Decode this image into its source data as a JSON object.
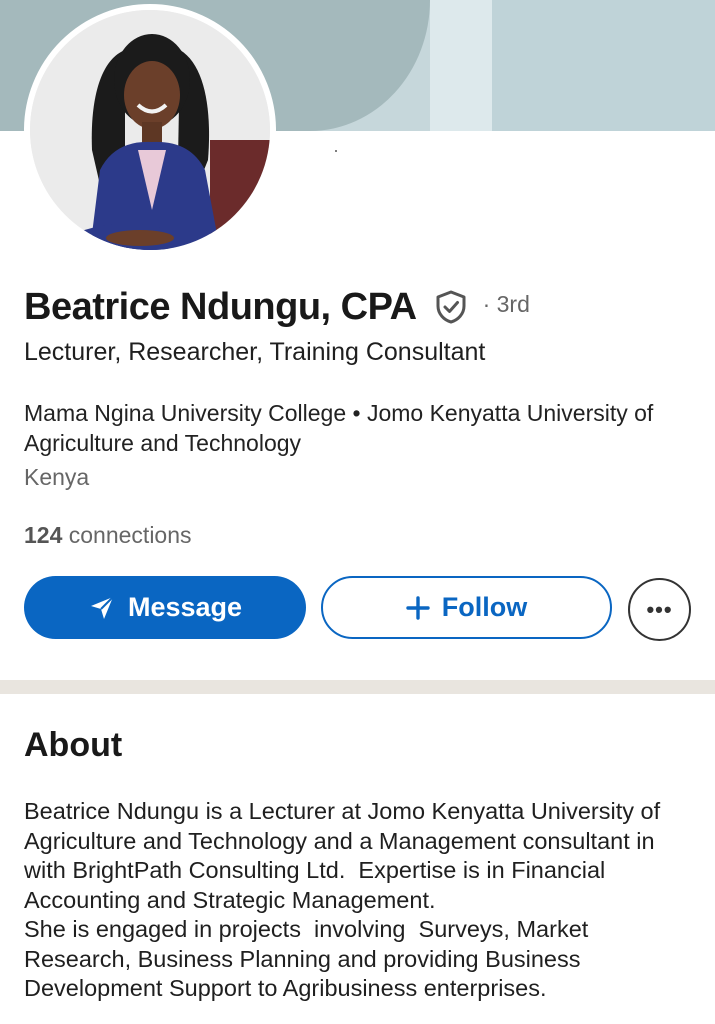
{
  "profile": {
    "name": "Beatrice Ndungu, CPA",
    "degree": "· 3rd",
    "headline": "Lecturer, Researcher, Training Consultant",
    "education": "Mama Ngina University College • Jomo Kenyatta University of Agriculture and Technology",
    "location": "Kenya",
    "connections_count": "124",
    "connections_label": " connections"
  },
  "actions": {
    "message_label": "Message",
    "follow_label": "Follow",
    "more_label": "•••"
  },
  "about": {
    "title": "About",
    "text": "Beatrice Ndungu is a Lecturer at Jomo Kenyatta University of Agriculture and Technology and a Management consultant in with BrightPath Consulting Ltd.  Expertise is in Financial Accounting and Strategic Management.\nShe is engaged in projects  involving  Surveys, Market Research, Business Planning and providing Business Development Support to Agribusiness enterprises."
  },
  "icons": {
    "verify": "shield-check-icon",
    "message": "paper-plane-icon",
    "follow": "plus-icon",
    "more": "ellipsis-icon"
  },
  "colors": {
    "brand_blue": "#0a66c2",
    "banner": "#a4b9bc",
    "divider": "#e9e5df",
    "muted_text": "#666666"
  }
}
